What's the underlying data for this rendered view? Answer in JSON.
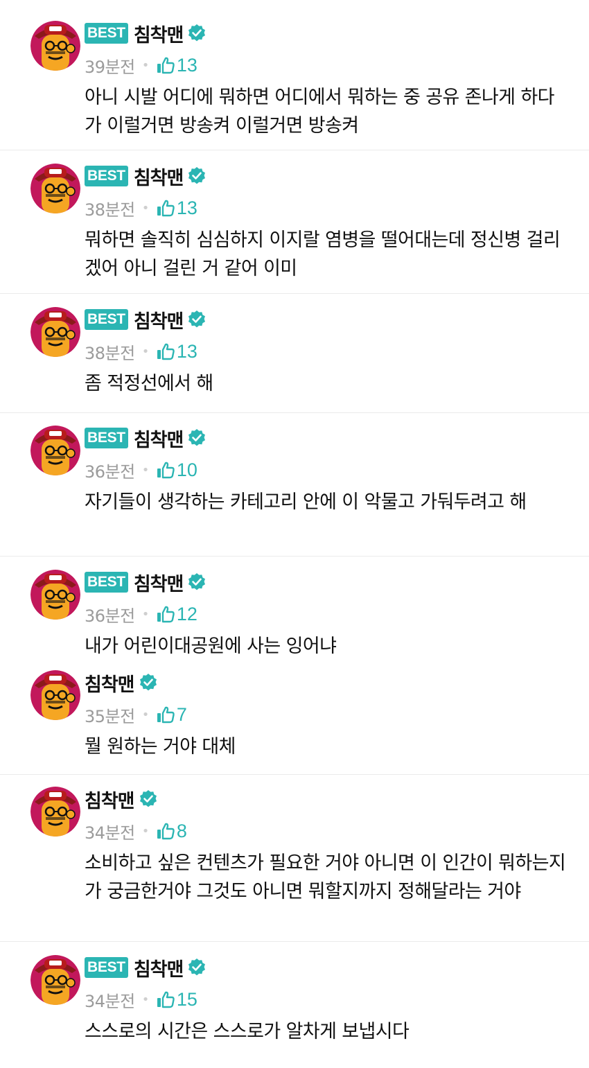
{
  "colors": {
    "accent": "#2bb5b3",
    "meta_gray": "#9b9b9b",
    "divider": "#ebebeb"
  },
  "comments": [
    {
      "best": "BEST",
      "name": "침착맨",
      "time": "39분전",
      "likes": "13",
      "text": "아니 시발 어디에 뭐하면 어디에서 뭐하는 중 공유 존나게 하다가 이럴거면 방송켜 이럴거면 방송켜"
    },
    {
      "best": "BEST",
      "name": "침착맨",
      "time": "38분전",
      "likes": "13",
      "text": "뭐하면 솔직히 심심하지 이지랄 염병을 떨어대는데 정신병 걸리겠어 아니 걸린 거 같어 이미"
    },
    {
      "best": "BEST",
      "name": "침착맨",
      "time": "38분전",
      "likes": "13",
      "text": "좀 적정선에서 해"
    },
    {
      "best": "BEST",
      "name": "침착맨",
      "time": "36분전",
      "likes": "10",
      "text": "자기들이 생각하는 카테고리 안에 이 악물고 가둬두려고 해"
    },
    {
      "best": "BEST",
      "name": "침착맨",
      "time": "36분전",
      "likes": "12",
      "text": "내가 어린이대공원에 사는 잉어냐"
    },
    {
      "best": "",
      "name": "침착맨",
      "time": "35분전",
      "likes": "7",
      "text": "뭘 원하는 거야 대체"
    },
    {
      "best": "",
      "name": "침착맨",
      "time": "34분전",
      "likes": "8",
      "text": "소비하고 싶은 컨텐츠가 필요한 거야 아니면 이 인간이 뭐하는지가 궁금한거야 그것도 아니면 뭐할지까지 정해달라는 거야"
    },
    {
      "best": "BEST",
      "name": "침착맨",
      "time": "34분전",
      "likes": "15",
      "text": "스스로의 시간은 스스로가 알차게 보냅시다"
    }
  ],
  "icons": {
    "verified": "verified-check-icon",
    "like": "thumbs-up-icon",
    "avatar": "avatar-caricature"
  }
}
